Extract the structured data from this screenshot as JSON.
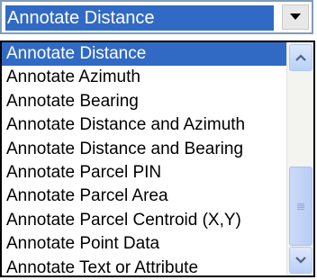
{
  "combo": {
    "selected_value": "Annotate Distance",
    "dropdown_icon": "chevron-down-icon"
  },
  "list": {
    "items": [
      {
        "label": "Annotate Distance",
        "selected": true
      },
      {
        "label": "Annotate Azimuth",
        "selected": false
      },
      {
        "label": "Annotate Bearing",
        "selected": false
      },
      {
        "label": "Annotate Distance and Azimuth",
        "selected": false
      },
      {
        "label": "Annotate Distance and Bearing",
        "selected": false
      },
      {
        "label": "Annotate Parcel PIN",
        "selected": false
      },
      {
        "label": "Annotate Parcel Area",
        "selected": false
      },
      {
        "label": "Annotate Parcel Centroid (X,Y)",
        "selected": false
      },
      {
        "label": "Annotate Point Data",
        "selected": false
      },
      {
        "label": "Annotate Text or Attribute",
        "selected": false
      }
    ]
  },
  "scrollbar": {
    "up_icon": "chevron-up-icon",
    "down_icon": "chevron-down-icon",
    "thumb_icon": "grip-icon"
  },
  "colors": {
    "selection": "#316ac5",
    "scrollbar_accent": "#4d6185"
  }
}
